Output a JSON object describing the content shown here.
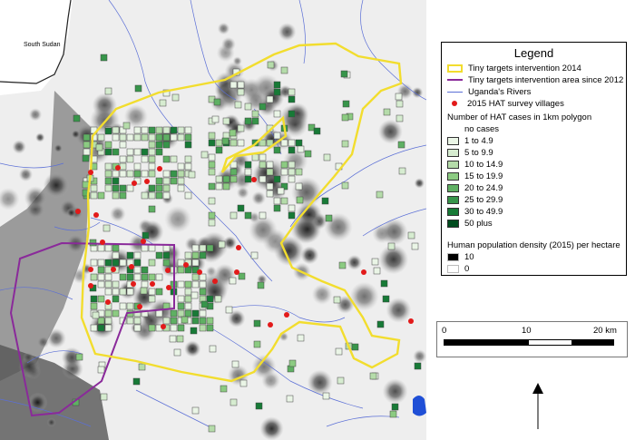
{
  "map": {
    "label_country": "South Sudan",
    "colors": {
      "intervention_2014": "#f2dd2e",
      "intervention_2012": "#8a2a9a",
      "rivers": "#5b6fd6",
      "villages": "#e21a1a",
      "lake": "#1f4fd6"
    }
  },
  "legend": {
    "title": "Legend",
    "entries": [
      {
        "label": "Tiny targets intervention 2014",
        "symbol": "yellow-outline-box"
      },
      {
        "label": "Tiny targets intervention area since 2012",
        "symbol": "purple-line"
      },
      {
        "label": "Uganda's Rivers",
        "symbol": "blue-line"
      },
      {
        "label": "2015 HAT survey villages",
        "symbol": "red-dot"
      }
    ],
    "cases_header": "Number of HAT cases in 1km polygon",
    "case_classes": [
      {
        "label": "no cases",
        "color": null
      },
      {
        "label": "1 to 4.9",
        "color": "#eaf5e6"
      },
      {
        "label": "5 to 9.9",
        "color": "#d6ecd0"
      },
      {
        "label": "10 to 14.9",
        "color": "#b5dcaa"
      },
      {
        "label": "15 to 19.9",
        "color": "#8ccb82"
      },
      {
        "label": "20 to 24.9",
        "color": "#5fb063"
      },
      {
        "label": "25 to 29.9",
        "color": "#37954a"
      },
      {
        "label": "30 to 49.9",
        "color": "#177a36"
      },
      {
        "label": "50 plus",
        "color": "#004c1e"
      }
    ],
    "density_header": "Human population density (2015) per hectare",
    "density_classes": [
      {
        "label": "10",
        "color": "#000000"
      },
      {
        "label": "0",
        "color": "#ffffff"
      }
    ]
  },
  "scale": {
    "labels": [
      "0",
      "10",
      "20 km"
    ]
  },
  "north_arrow": "north-arrow-icon"
}
